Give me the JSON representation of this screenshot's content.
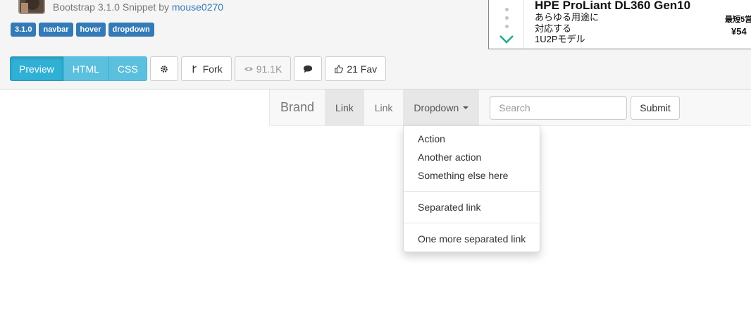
{
  "snippet": {
    "framework": "Bootstrap 3.1.0 Snippet by",
    "author": "mouse0270",
    "tags": [
      "3.1.0",
      "navbar",
      "hover",
      "dropdown"
    ]
  },
  "toolbar": {
    "preview": "Preview",
    "html": "HTML",
    "css": "CSS",
    "fork": "Fork",
    "views": "91.1K",
    "fav": "21 Fav"
  },
  "ad": {
    "title": "HPE ProLiant DL360 Gen10",
    "line1": "あらゆる用途に",
    "line2": "対応する",
    "line3": "1U2Pモデル",
    "right1": "最短5営",
    "right2": "¥54"
  },
  "navbar": {
    "brand": "Brand",
    "links": [
      "Link",
      "Link"
    ],
    "dropdown_label": "Dropdown",
    "search_placeholder": "Search",
    "submit_label": "Submit",
    "dropdown_items": {
      "group1": [
        "Action",
        "Another action",
        "Something else here"
      ],
      "group2": [
        "Separated link"
      ],
      "group3": [
        "One more separated link"
      ]
    }
  },
  "colors": {
    "tag_bg": "#337ab7",
    "preview_active": "#31b0d5",
    "info_button": "#5bc0de",
    "ad_chevron": "#1aaa8a"
  }
}
